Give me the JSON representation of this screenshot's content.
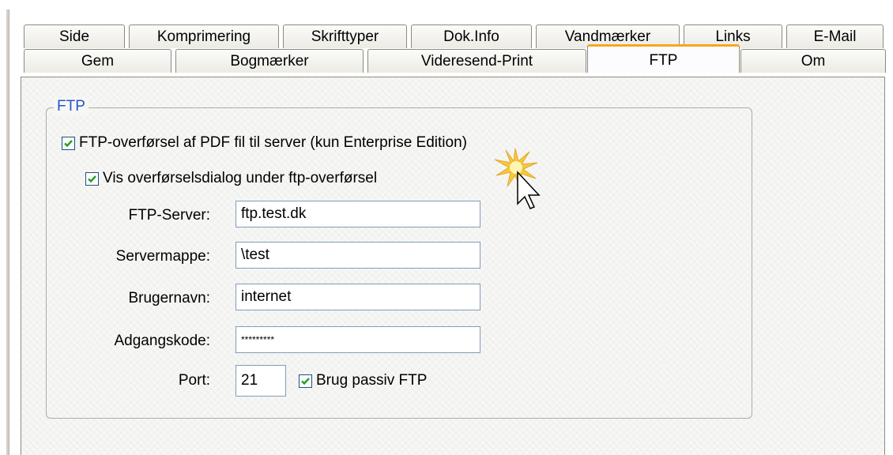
{
  "tabs_row1": [
    "Side",
    "Komprimering",
    "Skrifttyper",
    "Dok.Info",
    "Vandmærker",
    "Links",
    "E-Mail"
  ],
  "tabs_row2": [
    "Gem",
    "Bogmærker",
    "Videresend-Print",
    "FTP",
    "Om"
  ],
  "active_tab": "FTP",
  "group": {
    "title": "FTP",
    "ftp_transfer_label": "FTP-overførsel af PDF fil til server (kun Enterprise Edition)",
    "ftp_transfer_checked": true,
    "show_dialog_label": "Vis overførselsdialog under ftp-overførsel",
    "show_dialog_checked": true,
    "server_label": "FTP-Server:",
    "server_value": "ftp.test.dk",
    "folder_label": "Servermappe:",
    "folder_value": "\\test",
    "user_label": "Brugernavn:",
    "user_value": "internet",
    "password_label": "Adgangskode:",
    "password_value": "*********",
    "port_label": "Port:",
    "port_value": "21",
    "passive_label": "Brug passiv FTP",
    "passive_checked": true
  },
  "colors": {
    "accent_tab": "#f5a623",
    "group_title": "#2456c8",
    "checkmark": "#21a121"
  },
  "icons": [
    "checkmark-icon",
    "mouse-cursor-icon",
    "click-highlight-icon"
  ]
}
